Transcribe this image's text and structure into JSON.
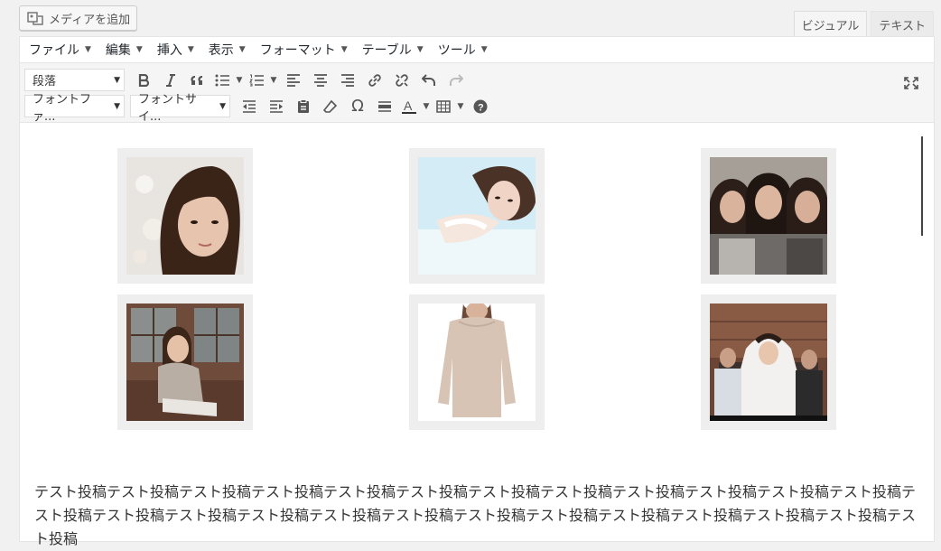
{
  "media_button": {
    "label": "メディアを追加",
    "icon": "media-icon"
  },
  "tabs": [
    {
      "label": "ビジュアル",
      "active": true
    },
    {
      "label": "テキスト",
      "active": false
    }
  ],
  "menubar": [
    {
      "label": "ファイル"
    },
    {
      "label": "編集"
    },
    {
      "label": "挿入"
    },
    {
      "label": "表示"
    },
    {
      "label": "フォーマット"
    },
    {
      "label": "テーブル"
    },
    {
      "label": "ツール"
    }
  ],
  "toolbar": {
    "format_select": "段落",
    "font_family_select": "フォントファ...",
    "font_size_select": "フォントサイ..."
  },
  "content": {
    "gallery_images": [
      "portrait-woman-bokeh",
      "woman-lying-light-blue",
      "three-women-group",
      "woman-sitting-porch",
      "woman-beige-sweater",
      "bride-with-family"
    ],
    "body_text": "テスト投稿テスト投稿テスト投稿テスト投稿テスト投稿テスト投稿テスト投稿テスト投稿テスト投稿テスト投稿テスト投稿テスト投稿テスト投稿テスト投稿テスト投稿テスト投稿テスト投稿テスト投稿テスト投稿テスト投稿テスト投稿テスト投稿テスト投稿テスト投稿テスト投稿"
  },
  "colors": {
    "accent": "#0073aa",
    "toolbar_bg": "#f5f5f5",
    "page_bg": "#f1f1f1"
  }
}
